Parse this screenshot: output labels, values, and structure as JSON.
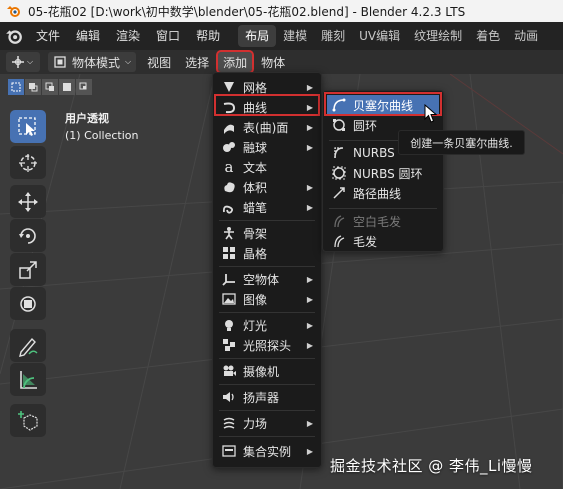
{
  "window": {
    "title": "05-花瓶02 [D:\\work\\初中数学\\blender\\05-花瓶02.blend] - Blender 4.2.3 LTS"
  },
  "menubar": {
    "items": [
      "文件",
      "编辑",
      "渲染",
      "窗口",
      "帮助"
    ],
    "workspaces": [
      "布局",
      "建模",
      "雕刻",
      "UV编辑",
      "纹理绘制",
      "着色",
      "动画"
    ],
    "active_workspace": "布局"
  },
  "header": {
    "mode": "物体模式",
    "menus": [
      "视图",
      "选择",
      "添加",
      "物体"
    ]
  },
  "viewport": {
    "view_name": "用户透视",
    "collection": "(1) Collection"
  },
  "add_menu": {
    "items": [
      {
        "label": "网格",
        "icon": "mesh-icon"
      },
      {
        "label": "曲线",
        "icon": "curve-icon"
      },
      {
        "label": "表(曲)面",
        "icon": "surface-icon"
      },
      {
        "label": "融球",
        "icon": "metaball-icon"
      },
      {
        "label": "文本",
        "icon": "text-icon"
      },
      {
        "label": "体积",
        "icon": "volume-icon"
      },
      {
        "label": "蜡笔",
        "icon": "grease-pencil-icon"
      },
      {
        "label": "骨架",
        "icon": "armature-icon"
      },
      {
        "label": "晶格",
        "icon": "lattice-icon"
      },
      {
        "label": "空物体",
        "icon": "empty-icon"
      },
      {
        "label": "图像",
        "icon": "image-icon"
      },
      {
        "label": "灯光",
        "icon": "light-icon"
      },
      {
        "label": "光照探头",
        "icon": "light-probe-icon"
      },
      {
        "label": "摄像机",
        "icon": "camera-icon"
      },
      {
        "label": "扬声器",
        "icon": "speaker-icon"
      },
      {
        "label": "力场",
        "icon": "force-field-icon"
      },
      {
        "label": "集合实例",
        "icon": "collection-instance-icon"
      }
    ]
  },
  "curve_menu": {
    "items": [
      {
        "label": "贝塞尔曲线",
        "icon": "bezier-curve-icon"
      },
      {
        "label": "圆环",
        "icon": "bezier-circle-icon"
      },
      {
        "label": "NURBS",
        "icon": "nurbs-curve-icon"
      },
      {
        "label": "NURBS 圆环",
        "icon": "nurbs-circle-icon"
      },
      {
        "label": "路径曲线",
        "icon": "path-curve-icon"
      },
      {
        "label": "空白毛发",
        "icon": "empty-hair-icon"
      },
      {
        "label": "毛发",
        "icon": "hair-icon"
      }
    ]
  },
  "tooltip": "创建一条贝塞尔曲线.",
  "watermark": "掘金技术社区 @ 李伟_Li慢慢",
  "colors": {
    "accent": "#4772b3",
    "highlight_border": "#d23030",
    "menu_bg": "#1b1b1b"
  }
}
